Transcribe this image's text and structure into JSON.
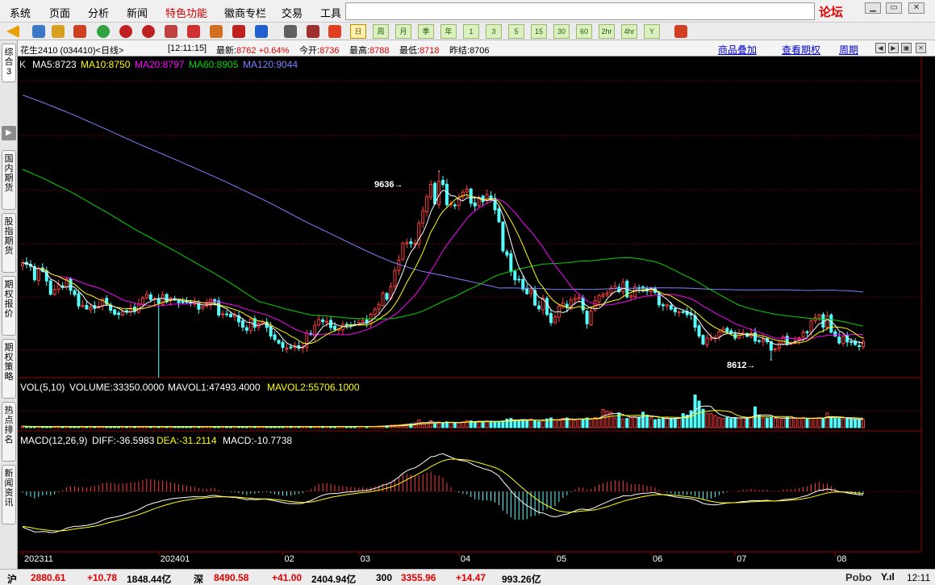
{
  "menu": {
    "items": [
      "系统",
      "页面",
      "分析",
      "新闻",
      "特色功能",
      "徽商专栏",
      "交易",
      "工具"
    ],
    "active": "特色功能",
    "forum": "论坛"
  },
  "toolbar": {
    "periods": [
      {
        "label": "日",
        "active": true
      },
      {
        "label": "周"
      },
      {
        "label": "月"
      },
      {
        "label": "季"
      },
      {
        "label": "年"
      },
      {
        "label": "1"
      },
      {
        "label": "3"
      },
      {
        "label": "5"
      },
      {
        "label": "15"
      },
      {
        "label": "30"
      },
      {
        "label": "60"
      },
      {
        "label": "2hr"
      },
      {
        "label": "4hr"
      },
      {
        "label": "Y"
      }
    ]
  },
  "sidebar": {
    "tabs": [
      "综合3",
      "国内期货",
      "股指期货",
      "期权报价",
      "期权策略",
      "热点排名",
      "新闻资讯"
    ]
  },
  "quote": {
    "name": "花生2410 (034410)<日线>",
    "time": "[12:11:15]",
    "latest_label": "最新:",
    "latest": "8762",
    "change": "+0.64%",
    "open_label": "今开:",
    "open": "8736",
    "high_label": "最高:",
    "high": "8788",
    "low_label": "最低:",
    "low": "8718",
    "prev_label": "昨结:",
    "prev": "8706"
  },
  "links": {
    "overlay": "商品叠加",
    "options": "查看期权",
    "period": "周期"
  },
  "ma_legend": {
    "k": "K",
    "ma5": "MA5:8723",
    "ma10": "MA10:8750",
    "ma20": "MA20:8797",
    "ma60": "MA60:8905",
    "ma120": "MA120:9044"
  },
  "vol_legend": {
    "label": "VOL(5,10)",
    "volume": "VOLUME:33350.0000",
    "mavol1": "MAVOL1:47493.4000",
    "mavol2": "MAVOL2:55706.1000"
  },
  "macd_legend": {
    "label": "MACD(12,26,9)",
    "diff": "DIFF:-36.5983",
    "dea": "DEA:-31.2114",
    "macd": "MACD:-10.7738"
  },
  "annotations": {
    "high": "9636",
    "low": "8612"
  },
  "chart_data": {
    "type": "candlestick",
    "x_ticks": [
      "202311",
      "202401",
      "02",
      "03",
      "04",
      "05",
      "06",
      "07",
      "08"
    ],
    "ylim": [
      8520,
      10250
    ],
    "max_price": 9636,
    "min_price": 8612,
    "colors": {
      "up": "#ff3c3c",
      "down": "#54ffff",
      "ma5": "#ffffff",
      "ma10": "#ffff00",
      "ma20": "#ff00ff",
      "ma60": "#00d700",
      "ma120": "#8080ff",
      "diff": "#ffffff",
      "dea": "#ffff00",
      "grid": "#9a0000"
    },
    "closes": [
      9138,
      9130,
      9119,
      9047,
      9107,
      9092,
      9041,
      8969,
      8996,
      9021,
      9006,
      9051,
      8990,
      8967,
      8906,
      8910,
      8890,
      8901,
      8893,
      8905,
      8942,
      8917,
      8883,
      8862,
      8860,
      8877,
      8879,
      8894,
      8877,
      8917,
      8949,
      8968,
      8941,
      8945,
      8921,
      8966,
      8928,
      8949,
      8938,
      8924,
      8925,
      8925,
      8921,
      8925,
      8889,
      8903,
      8916,
      8941,
      8926,
      8857,
      8864,
      8863,
      8848,
      8859,
      8820,
      8792,
      8775,
      8836,
      8792,
      8813,
      8822,
      8790,
      8744,
      8726,
      8706,
      8683,
      8678,
      8681,
      8693,
      8678,
      8685,
      8759,
      8752,
      8801,
      8833,
      8821,
      8824,
      8790,
      8779,
      8783,
      8807,
      8806,
      8803,
      8804,
      8817,
      8829,
      8815,
      8861,
      8888,
      8913,
      8976,
      8943,
      9011,
      9096,
      9153,
      9243,
      9247,
      9242,
      9243,
      9352,
      9420,
      9495,
      9561,
      9456,
      9577,
      9560,
      9451,
      9456,
      9446,
      9488,
      9519,
      9535,
      9459,
      9445,
      9491,
      9468,
      9505,
      9481,
      9424,
      9360,
      9203,
      9180,
      9091,
      9047,
      9048,
      8996,
      8972,
      8992,
      8911,
      8891,
      8948,
      8860,
      8816,
      8848,
      8905,
      8922,
      8897,
      8938,
      8947,
      8952,
      8884,
      8810,
      8878,
      8934,
      8962,
      8966,
      8975,
      9002,
      9012,
      8983,
      9034,
      8955,
      8961,
      9009,
      9002,
      9001,
      8987,
      8999,
      8979,
      8912,
      8907,
      8913,
      8889,
      8874,
      8875,
      8872,
      8859,
      8858,
      8792,
      8744,
      8701,
      8733,
      8732,
      8737,
      8768,
      8781,
      8766,
      8758,
      8733,
      8756,
      8761,
      8742,
      8758,
      8717,
      8716,
      8726,
      8713,
      8668,
      8675,
      8706,
      8739,
      8700,
      8704,
      8719,
      8734,
      8764,
      8762,
      8825,
      8843,
      8858,
      8792,
      8852,
      8764,
      8744,
      8707,
      8740,
      8712,
      8711,
      8698,
      8692,
      8714
    ],
    "volumes": [
      6000,
      4500,
      4400,
      4400,
      4400,
      4400,
      4400,
      4400,
      4400,
      4400,
      4400,
      4400,
      4400,
      4400,
      4400,
      4400,
      4400,
      4400,
      4400,
      4400,
      4400,
      4400,
      4400,
      4400,
      4400,
      4400,
      4400,
      4400,
      4400,
      4400,
      4400,
      4400,
      4400,
      4400,
      4400,
      4400,
      4400,
      4400,
      4400,
      4400,
      4400,
      4400,
      4400,
      4400,
      4400,
      4400,
      4400,
      4400,
      4400,
      4400,
      4400,
      4400,
      4400,
      4400,
      4400,
      4400,
      4400,
      4400,
      4400,
      4400,
      4400,
      4400,
      4400,
      4400,
      4400,
      4400,
      4400,
      4400,
      4400,
      4400,
      4400,
      4400,
      4400,
      4400,
      4400,
      4400,
      4400,
      4400,
      5000,
      5000,
      5000,
      5000,
      5000,
      5000,
      5000,
      5000,
      5000,
      5000,
      5000,
      6000,
      7000,
      8000,
      10000,
      11000,
      11000,
      13000,
      15000,
      16000,
      20000,
      32000,
      20000,
      18000,
      28000,
      15000,
      24000,
      18000,
      24000,
      22000,
      20000,
      20000,
      24000,
      30000,
      28000,
      23000,
      26000,
      24000,
      28000,
      27000,
      25000,
      26000,
      28000,
      35000,
      38000,
      32000,
      28000,
      33000,
      32000,
      36000,
      30000,
      26000,
      28000,
      36000,
      40000,
      33000,
      30000,
      38000,
      40000,
      36000,
      30000,
      36000,
      36000,
      40000,
      38000,
      42000,
      40000,
      75000,
      68000,
      64000,
      40000,
      60000,
      36000,
      38000,
      42000,
      45000,
      44000,
      64000,
      52000,
      40000,
      33000,
      36000,
      38000,
      40000,
      38000,
      38000,
      40000,
      58000,
      52000,
      70000,
      135000,
      110000,
      76000,
      58000,
      58000,
      50000,
      42000,
      38000,
      42000,
      38000,
      42000,
      40000,
      40000,
      40000,
      45000,
      86000,
      50000,
      40000,
      40000,
      42000,
      38000,
      40000,
      38000,
      42000,
      40000,
      38000,
      38000,
      42000,
      36000,
      38000,
      40000,
      42000,
      40000,
      60000,
      45000,
      38000,
      38000,
      36000,
      38000,
      36000,
      33000,
      33000,
      33350
    ],
    "annotations": [
      {
        "label": "9636",
        "value": 9636
      },
      {
        "label": "8612",
        "value": 8612
      }
    ]
  }
}
